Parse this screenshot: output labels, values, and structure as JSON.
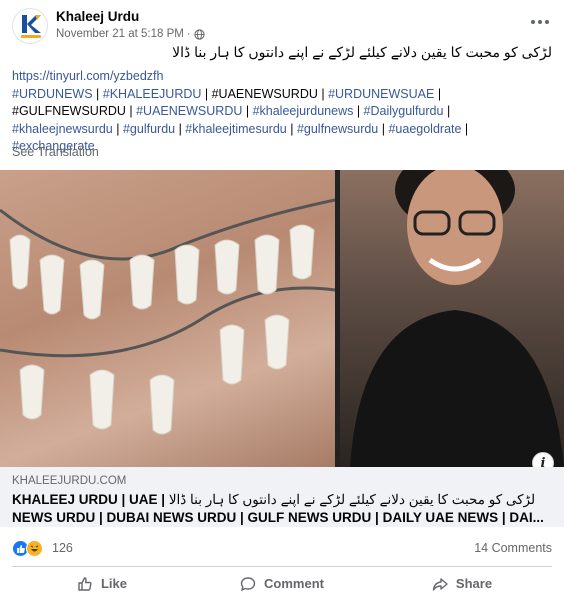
{
  "post": {
    "page_name": "Khaleej Urdu",
    "timestamp": "November 21 at 5:18 PM",
    "separator": "·",
    "urdu_title": "لڑکی کو محبت کا یقین دلانے کیلئے لڑکے نے اپنے دانتوں کا ہار بنا ڈالا",
    "link": "https://tinyurl.com/yzbedzfh",
    "hashtags": [
      {
        "text": "#URDUNEWS",
        "link": true
      },
      {
        "text": "#KHALEEJURDU",
        "link": true
      },
      {
        "text": "#UAENEWSURDU",
        "link": false
      },
      {
        "text": "#URDUNEWSUAE",
        "link": true
      },
      {
        "text": "#GULFNEWSURDU",
        "link": false
      },
      {
        "text": "#UAENEWSURDU",
        "link": true
      },
      {
        "text": "#khaleejurdunews",
        "link": true
      },
      {
        "text": "#Dailygulfurdu",
        "link": true
      },
      {
        "text": "#khaleejnewsurdu",
        "link": true
      },
      {
        "text": "#gulfurdu",
        "link": true
      },
      {
        "text": "#khaleejtimesurdu",
        "link": true
      },
      {
        "text": "#gulfnewsurdu",
        "link": true
      },
      {
        "text": "#uaegoldrate",
        "link": true
      },
      {
        "text": "#exchangerate",
        "link": true
      }
    ],
    "see_translation": "See Translation",
    "info_icon_label": "i"
  },
  "link_preview": {
    "domain": "KHALEEJURDU.COM",
    "title_prefix": "KHALEEJ URDU | UAE |",
    "title_urdu": "لڑکی کو محبت کا یقین دلانے کیلئے لڑکے نے اپنے دانتوں کا ہار بنا ڈالا",
    "title_suffix": "NEWS URDU | DUBAI NEWS URDU | GULF NEWS URDU | DAILY UAE NEWS | DAI..."
  },
  "engagement": {
    "reaction_count": "126",
    "comments": "14 Comments"
  },
  "actions": {
    "like": "Like",
    "comment": "Comment",
    "share": "Share"
  },
  "colors": {
    "link": "#385898",
    "secondary_text": "#65676b",
    "like_blue": "#1877f2",
    "haha_yellow": "#f7b125",
    "logo_blue": "#1a4fa0",
    "logo_orange": "#f5a623"
  }
}
